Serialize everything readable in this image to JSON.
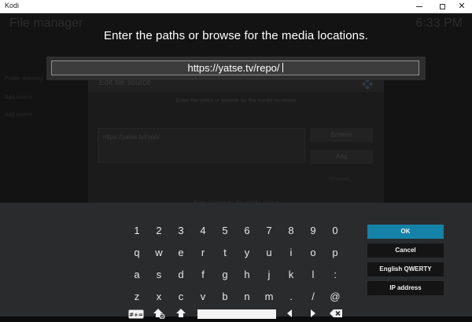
{
  "window": {
    "title": "Kodi",
    "controls": {
      "minimize": "minimize",
      "maximize": "maximize",
      "close": "✕"
    }
  },
  "background": {
    "heading": "File manager",
    "clock": "6:33 PM",
    "menu_items": [
      "Profile directory",
      "Add source",
      "Add source"
    ],
    "dialog": {
      "title": "Edit file source",
      "instruction": "Enter the paths or browse for the media locations",
      "path": "https://yatse.tv/repo/",
      "browse_label": "Browse",
      "add_label": "Add",
      "remove_label": "Remove",
      "name_instruction": "Enter a name for this media source"
    }
  },
  "keyboard": {
    "heading": "Enter the paths or browse for the media locations.",
    "input_value": "https://yatse.tv/repo/",
    "rows": [
      [
        "1",
        "2",
        "3",
        "4",
        "5",
        "6",
        "7",
        "8",
        "9",
        "0"
      ],
      [
        "q",
        "w",
        "e",
        "r",
        "t",
        "y",
        "u",
        "i",
        "o",
        "p"
      ],
      [
        "a",
        "s",
        "d",
        "f",
        "g",
        "h",
        "j",
        "k",
        "l",
        ":"
      ],
      [
        "z",
        "x",
        "c",
        "v",
        "b",
        "n",
        "m",
        ".",
        "/",
        "@"
      ]
    ],
    "bottom_keys": {
      "symbols": "#+=",
      "shift": "shift",
      "caps": "caps-lock",
      "space": "space",
      "left": "left",
      "right": "right",
      "backspace": "backspace"
    },
    "buttons": {
      "ok": "OK",
      "cancel": "Cancel",
      "layout": "English QWERTY",
      "ip": "IP address"
    },
    "colors": {
      "accent": "#1582a8",
      "panel": "#2a2b2d",
      "button": "#141414"
    }
  }
}
